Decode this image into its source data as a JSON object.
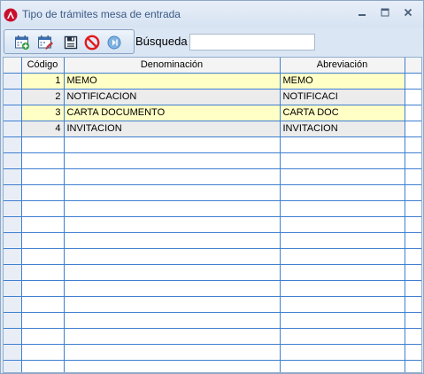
{
  "window": {
    "title": "Tipo de trámites mesa de entrada",
    "controls": [
      "minimize",
      "maximize",
      "close"
    ]
  },
  "toolbar": {
    "buttons": [
      {
        "name": "new-record",
        "icon": "calendar-add-icon"
      },
      {
        "name": "edit-record",
        "icon": "calendar-edit-icon"
      },
      {
        "name": "save",
        "icon": "floppy-save-icon"
      },
      {
        "name": "cancel",
        "icon": "no-entry-cancel-icon"
      },
      {
        "name": "exit",
        "icon": "circle-arrow-exit-icon"
      }
    ],
    "search_label": "Búsqueda",
    "search_value": ""
  },
  "grid": {
    "columns": [
      "Código",
      "Denominación",
      "Abreviación"
    ],
    "rows": [
      {
        "codigo": "1",
        "denominacion": "MEMO",
        "abreviacion": "MEMO"
      },
      {
        "codigo": "2",
        "denominacion": "NOTIFICACION",
        "abreviacion": "NOTIFICACI"
      },
      {
        "codigo": "3",
        "denominacion": "CARTA DOCUMENTO",
        "abreviacion": "CARTA DOC"
      },
      {
        "codigo": "4",
        "denominacion": "INVITACION",
        "abreviacion": "INVITACION"
      }
    ],
    "highlight_color": "#ffffc6",
    "grid_line_color": "#3f7fd1"
  }
}
